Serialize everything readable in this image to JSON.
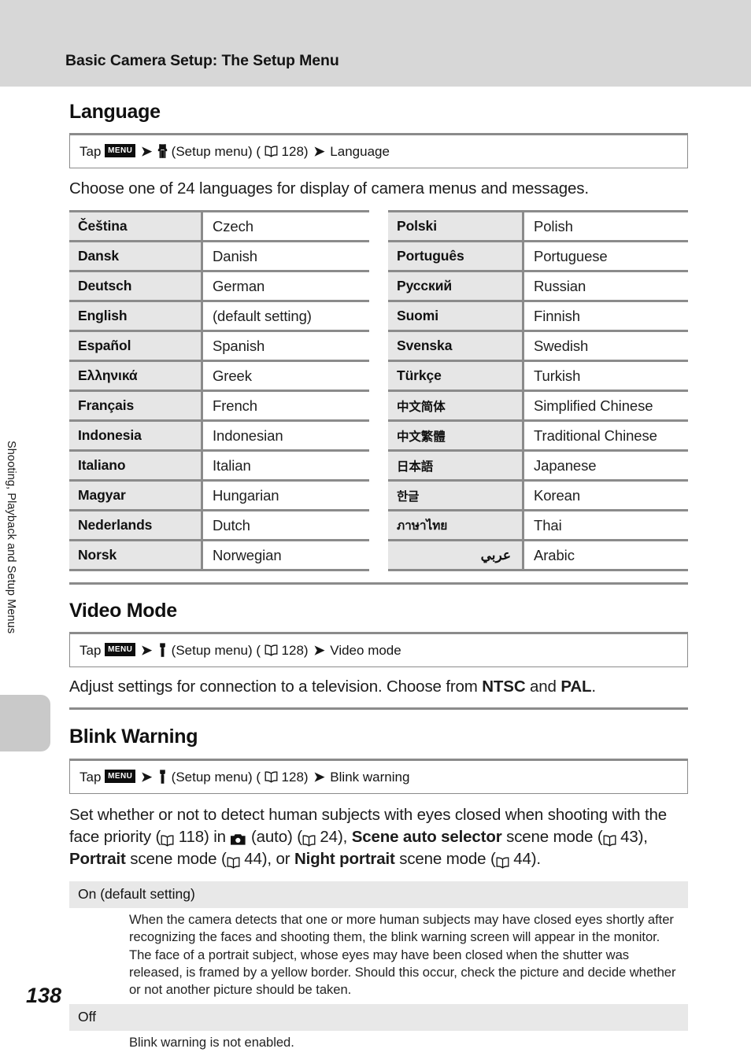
{
  "header": {
    "running_title": "Basic Camera Setup: The Setup Menu"
  },
  "side_tab": {
    "label": "Shooting, Playback and Setup Menus"
  },
  "page_number": "138",
  "icons": {
    "menu": "menu-icon",
    "arrow": "➔",
    "wrench": "wrench-icon",
    "book": "book-icon",
    "camera": "camera-icon"
  },
  "sections": [
    {
      "heading": "Language",
      "tap_path": {
        "tap_label": "Tap",
        "menu_button": "MENU",
        "setup_menu_label": "(Setup menu)",
        "page_ref_open": "(",
        "page_ref": "128",
        "page_ref_close": ")",
        "target": "Language"
      },
      "intro": "Choose one of 24 languages for display of camera menus and messages."
    },
    {
      "heading": "Video Mode",
      "tap_path": {
        "tap_label": "Tap",
        "menu_button": "MENU",
        "setup_menu_label": "(Setup menu)",
        "page_ref_open": "(",
        "page_ref": "128",
        "page_ref_close": ")",
        "target": "Video mode"
      },
      "body_parts": {
        "lead": "Adjust settings for connection to a television. Choose from ",
        "bold1": "NTSC",
        "mid": " and ",
        "bold2": "PAL",
        "tail": "."
      }
    },
    {
      "heading": "Blink Warning",
      "tap_path": {
        "tap_label": "Tap",
        "menu_button": "MENU",
        "setup_menu_label": "(Setup menu)",
        "page_ref_open": "(",
        "page_ref": "128",
        "page_ref_close": ")",
        "target": "Blink warning"
      },
      "body_parts": {
        "t1": "Set whether or not to detect human subjects with eyes closed when shooting with the face priority (",
        "ref1": "118",
        "t2": ") in ",
        "t3": " (auto) (",
        "ref2": "24",
        "t4": "), ",
        "bold1": "Scene auto selector",
        "t5": " scene mode (",
        "ref3": "43",
        "t6": "), ",
        "bold2": "Portrait",
        "t7": " scene mode (",
        "ref4": "44",
        "t8": "), or ",
        "bold3": "Night portrait",
        "t9": " scene mode (",
        "ref5": "44",
        "t10": ")."
      },
      "options": [
        {
          "label": "On (default setting)",
          "paragraphs": [
            "When the camera detects that one or more human subjects may have closed eyes shortly after recognizing the faces and shooting them, the blink warning screen will appear in the monitor.",
            "The face of a portrait subject, whose eyes may have been closed when the shutter was released, is framed by a yellow border. Should this occur, check the picture and decide whether or not another picture should be taken."
          ]
        },
        {
          "label": "Off",
          "paragraphs": [
            "Blink warning is not enabled."
          ]
        }
      ]
    }
  ],
  "language_table": {
    "left": [
      {
        "native": "Čeština",
        "english": "Czech"
      },
      {
        "native": "Dansk",
        "english": "Danish"
      },
      {
        "native": "Deutsch",
        "english": "German"
      },
      {
        "native": "English",
        "english": "(default setting)"
      },
      {
        "native": "Español",
        "english": "Spanish"
      },
      {
        "native": "Ελληνικά",
        "english": "Greek"
      },
      {
        "native": "Français",
        "english": "French"
      },
      {
        "native": "Indonesia",
        "english": "Indonesian"
      },
      {
        "native": "Italiano",
        "english": "Italian"
      },
      {
        "native": "Magyar",
        "english": "Hungarian"
      },
      {
        "native": "Nederlands",
        "english": "Dutch"
      },
      {
        "native": "Norsk",
        "english": "Norwegian"
      }
    ],
    "right": [
      {
        "native": "Polski",
        "english": "Polish"
      },
      {
        "native": "Português",
        "english": "Portuguese"
      },
      {
        "native": "Русский",
        "english": "Russian"
      },
      {
        "native": "Suomi",
        "english": "Finnish"
      },
      {
        "native": "Svenska",
        "english": "Swedish"
      },
      {
        "native": "Türkçe",
        "english": "Turkish"
      },
      {
        "native": "中文简体",
        "english": "Simplified Chinese",
        "script": true
      },
      {
        "native": "中文繁體",
        "english": "Traditional Chinese",
        "script": true
      },
      {
        "native": "日本語",
        "english": "Japanese",
        "script": true
      },
      {
        "native": "한글",
        "english": "Korean",
        "script": true
      },
      {
        "native": "ภาษาไทย",
        "english": "Thai",
        "script": true
      },
      {
        "native": "عربي",
        "english": "Arabic",
        "rtl": true
      }
    ]
  },
  "colors": {
    "header_band": "#d7d7d7",
    "rule": "#8b8b8b",
    "native_cell_bg": "#e6e6e6",
    "option_header_bg": "#e8e8e8",
    "side_tab_block": "#c9c9c9"
  }
}
